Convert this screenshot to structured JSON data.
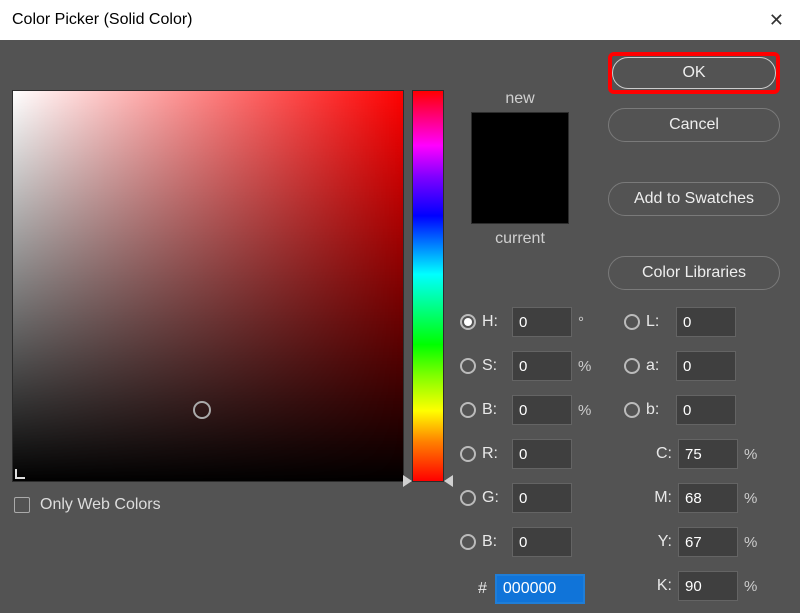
{
  "title": "Color Picker (Solid Color)",
  "close_glyph": "✕",
  "swatch": {
    "new_label": "new",
    "current_label": "current",
    "new_color": "#000000",
    "current_color": "#000000"
  },
  "buttons": {
    "ok": "OK",
    "cancel": "Cancel",
    "add_swatches": "Add to Swatches",
    "color_libraries": "Color Libraries"
  },
  "only_web_colors_label": "Only Web Colors",
  "only_web_colors_checked": false,
  "hsb": {
    "h_label": "H:",
    "h_value": "0",
    "h_unit": "°",
    "h_selected": true,
    "s_label": "S:",
    "s_value": "0",
    "s_unit": "%",
    "b_label": "B:",
    "b_value": "0",
    "b_unit": "%"
  },
  "lab": {
    "l_label": "L:",
    "l_value": "0",
    "a_label": "a:",
    "a_value": "0",
    "b_label": "b:",
    "b_value": "0"
  },
  "rgb": {
    "r_label": "R:",
    "r_value": "0",
    "g_label": "G:",
    "g_value": "0",
    "b_label": "B:",
    "b_value": "0"
  },
  "cmyk": {
    "c_label": "C:",
    "c_value": "75",
    "c_unit": "%",
    "m_label": "M:",
    "m_value": "68",
    "m_unit": "%",
    "y_label": "Y:",
    "y_value": "67",
    "y_unit": "%",
    "k_label": "K:",
    "k_value": "90",
    "k_unit": "%"
  },
  "hex": {
    "hash": "#",
    "value": "000000"
  },
  "hue_value": 0
}
